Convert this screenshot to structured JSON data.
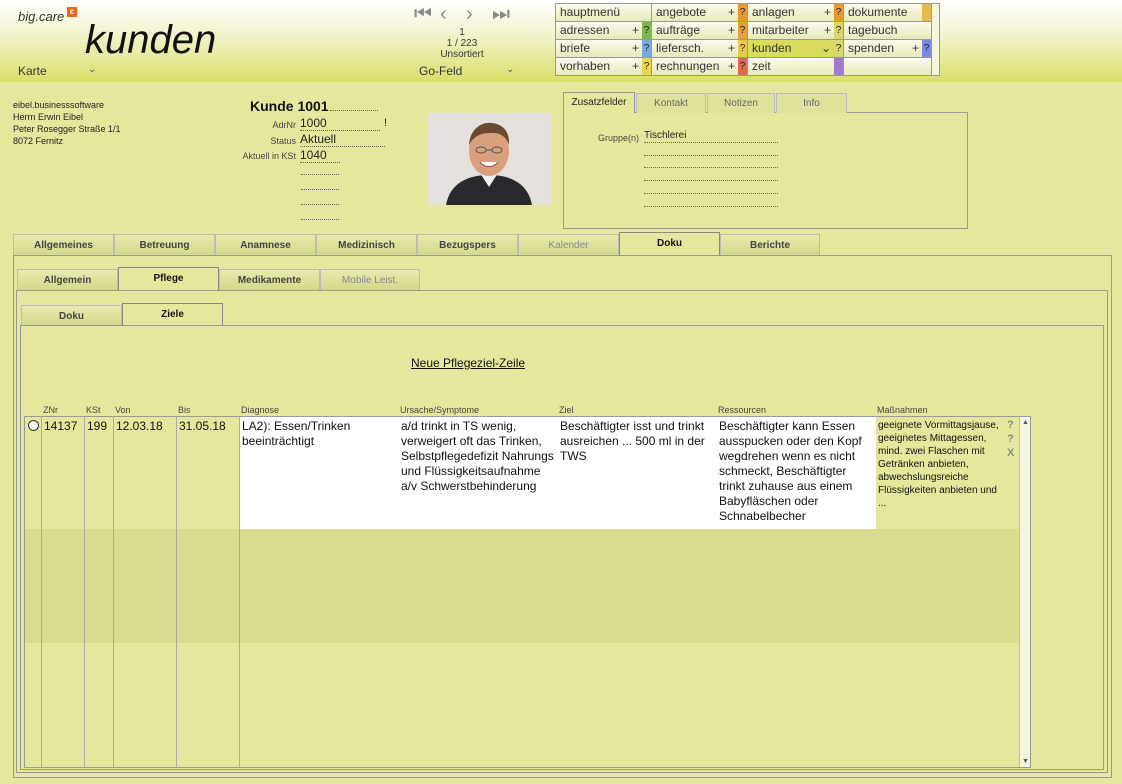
{
  "app": {
    "brand": "big.care",
    "brand_badge": "c",
    "title": "kunden",
    "view": "Karte",
    "go_field": "Go-Feld"
  },
  "nav": {
    "first": "K",
    "prev": "<",
    "next": ">",
    "last": ">I",
    "position": "1",
    "count": "1 / 223",
    "sort": "Unsortiert"
  },
  "menu": [
    {
      "label": "hauptmenü",
      "plus": "",
      "q": "",
      "color": ""
    },
    {
      "label": "angebote",
      "plus": "+",
      "q": "?",
      "color": "#e89a2e"
    },
    {
      "label": "anlagen",
      "plus": "+",
      "q": "?",
      "color": "#e89a2e"
    },
    {
      "label": "dokumente",
      "plus": "",
      "q": "",
      "color": "#e8b84a"
    },
    {
      "label": "adressen",
      "plus": "+",
      "q": "?",
      "color": "#7ab84a"
    },
    {
      "label": "aufträge",
      "plus": "+",
      "q": "?",
      "color": "#e8a03a"
    },
    {
      "label": "mitarbeiter",
      "plus": "+",
      "q": "?",
      "color": "#d8d86a"
    },
    {
      "label": "tagebuch",
      "plus": "",
      "q": "",
      "color": ""
    },
    {
      "label": "briefe",
      "plus": "+",
      "q": "?",
      "color": "#7aa8e0"
    },
    {
      "label": "liefersch.",
      "plus": "+",
      "q": "?",
      "color": "#e8c84a"
    },
    {
      "label": "kunden",
      "plus": "⌄",
      "q": "?",
      "color": "#d8d86a"
    },
    {
      "label": "spenden",
      "plus": "+",
      "q": "?",
      "color": "#7a8ae0"
    },
    {
      "label": "vorhaben",
      "plus": "+",
      "q": "?",
      "color": "#e8d84a"
    },
    {
      "label": "rechnungen",
      "plus": "+",
      "q": "?",
      "color": "#e06a4a"
    },
    {
      "label": "zeit",
      "plus": "",
      "q": "",
      "color": "#a07ad0"
    },
    {
      "label": "",
      "plus": "",
      "q": "",
      "color": ""
    }
  ],
  "address": [
    "eibel.businesssoftware",
    "Herrn Erwin Eibel",
    "Peter Rosegger Straße 1/1",
    "8072 Fernitz"
  ],
  "kunde": {
    "title": "Kunde 1001",
    "adrnr_label": "AdrNr",
    "adrnr": "1000",
    "adrnr_flag": "!",
    "status_label": "Status",
    "status": "Aktuell",
    "kst_label": "Aktuell in KSt",
    "kst": "1040"
  },
  "zusatz": {
    "tabs": [
      "Zusatzfelder",
      "Kontakt",
      "Notizen",
      "Info"
    ],
    "gruppe_label": "Gruppe(n)",
    "gruppe_value": "Tischlerei"
  },
  "main_tabs": [
    "Allgemeines",
    "Betreuung",
    "Anamnese",
    "Medizinisch",
    "Bezugspers",
    "Kalender",
    "Doku",
    "Berichte"
  ],
  "sub_tabs": [
    "Allgemein",
    "Pflege",
    "Medikamente",
    "Mobile Leist."
  ],
  "sub_sub_tabs": [
    "Doku",
    "Ziele"
  ],
  "new_row_link": "Neue Pflegeziel-Zeile",
  "table": {
    "headers": [
      "ZNr",
      "KSt",
      "Von",
      "Bis",
      "Diagnose",
      "Ursache/Symptome",
      "Ziel",
      "Ressourcen",
      "Maßnahmen"
    ],
    "row": {
      "znr": "14137",
      "kst": "199",
      "von": "12.03.18",
      "bis": "31.05.18",
      "diagnose": "LA2): Essen/Trinken beeinträchtigt",
      "ursache": "a/d trinkt in TS wenig, verweigert oft das Trinken, Selbstpflegedefizit Nahrungs und Flüssigkeitsaufnahme a/v Schwerstbehinderung",
      "ziel": "Beschäftigter isst und trinkt ausreichen ... 500 ml in der TWS",
      "ressourcen": "Beschäftigter kann Essen ausspucken oder den Kopf wegdrehen wenn es nicht schmeckt, Beschäftigter trinkt zuhause aus einem Babyfläschen oder Schnabelbecher",
      "massnahmen": "geeignete Vormittagsjause, geeignetes Mittagessen, mind. zwei Flaschen mit Getränken anbieten, abwechslungsreiche Flüssigkeiten anbieten und ..."
    },
    "side_q1": "?",
    "side_q2": "?",
    "side_x": "X"
  }
}
